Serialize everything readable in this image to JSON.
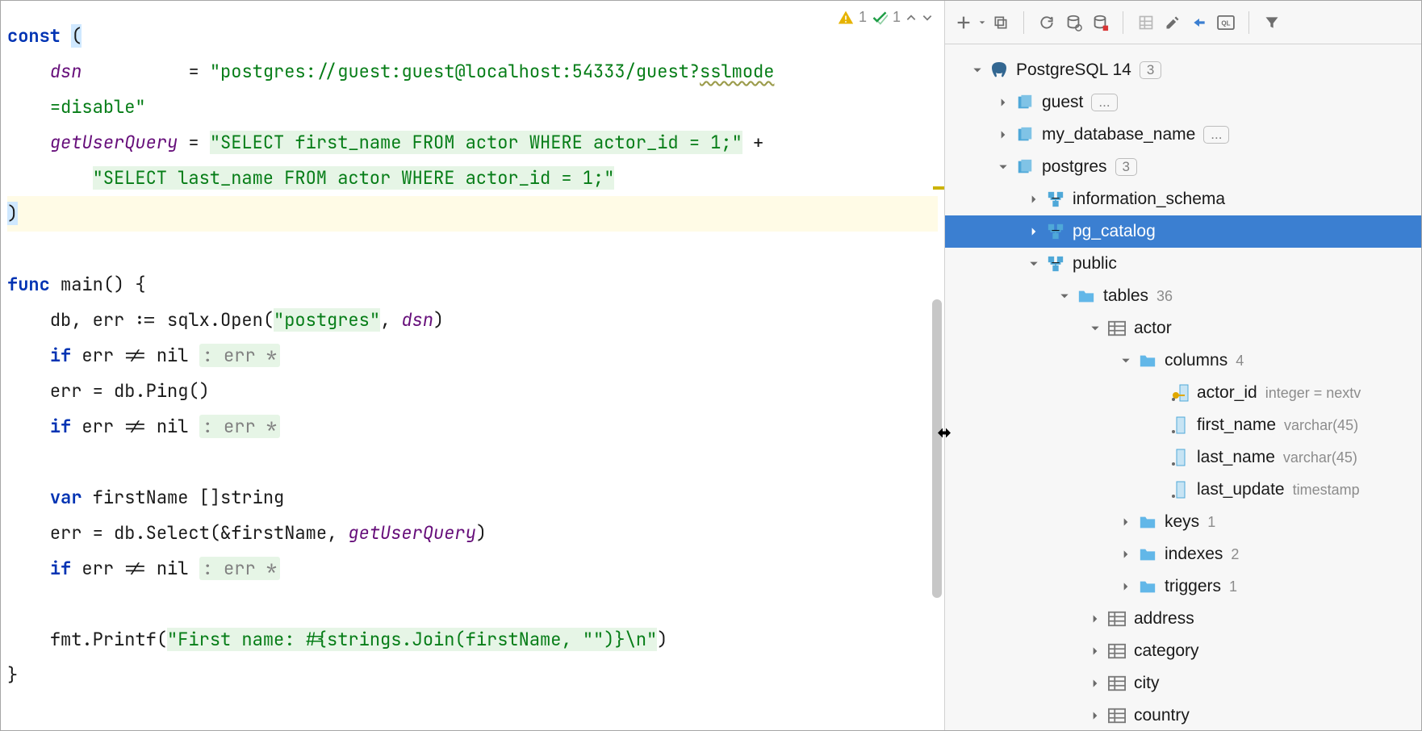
{
  "inspection": {
    "warnings": "1",
    "oks": "1"
  },
  "code": {
    "l1_const": "const",
    "l1_paren": "(",
    "dsn_name": "dsn",
    "eq": "=",
    "dsn_val_a": "\"postgres://guest:guest@localhost:54333/guest?",
    "dsn_val_wavy": "sslmode",
    "dsn_val_b": "=disable\"",
    "guq_name": "getUserQuery",
    "guq_a": "\"SELECT first_name FROM actor WHERE actor_id = 1;\"",
    "plus": "+",
    "guq_b": "\"SELECT last_name FROM actor WHERE actor_id = 1;\"",
    "close_paren": ")",
    "func": "func",
    "main": "main() {",
    "db_open_a": "db, err := sqlx.Open(",
    "db_open_b": "\"postgres\"",
    "db_open_c": ", ",
    "db_open_d": "dsn",
    "db_open_e": ")",
    "if_err": "if",
    "err_ne_nil": "err != nil",
    "err_hint": ": err *",
    "ping": "err = db.Ping()",
    "var": "var",
    "firstname_decl": "firstName []string",
    "select_a": "err = db.Select(&firstName, ",
    "select_b": "getUserQuery",
    "select_c": ")",
    "printf_a": "fmt.Printf(",
    "printf_b": "\"First name: #{strings.Join(firstName, \"\")}\\n\"",
    "printf_c": ")",
    "close_brace": "}"
  },
  "tree": {
    "root": "PostgreSQL 14",
    "root_count": "3",
    "db_guest": "guest",
    "ellipsis": "...",
    "db_mydb": "my_database_name",
    "db_postgres": "postgres",
    "postgres_count": "3",
    "schema_info": "information_schema",
    "schema_pg": "pg_catalog",
    "schema_public": "public",
    "tables": "tables",
    "tables_count": "36",
    "actor": "actor",
    "columns": "columns",
    "columns_count": "4",
    "col_actor_id": "actor_id",
    "col_actor_id_t": "integer = nextv",
    "col_first": "first_name",
    "col_first_t": "varchar(45)",
    "col_last": "last_name",
    "col_last_t": "varchar(45)",
    "col_upd": "last_update",
    "col_upd_t": "timestamp",
    "keys": "keys",
    "keys_count": "1",
    "indexes": "indexes",
    "indexes_count": "2",
    "triggers": "triggers",
    "triggers_count": "1",
    "t_address": "address",
    "t_category": "category",
    "t_city": "city",
    "t_country": "country"
  }
}
